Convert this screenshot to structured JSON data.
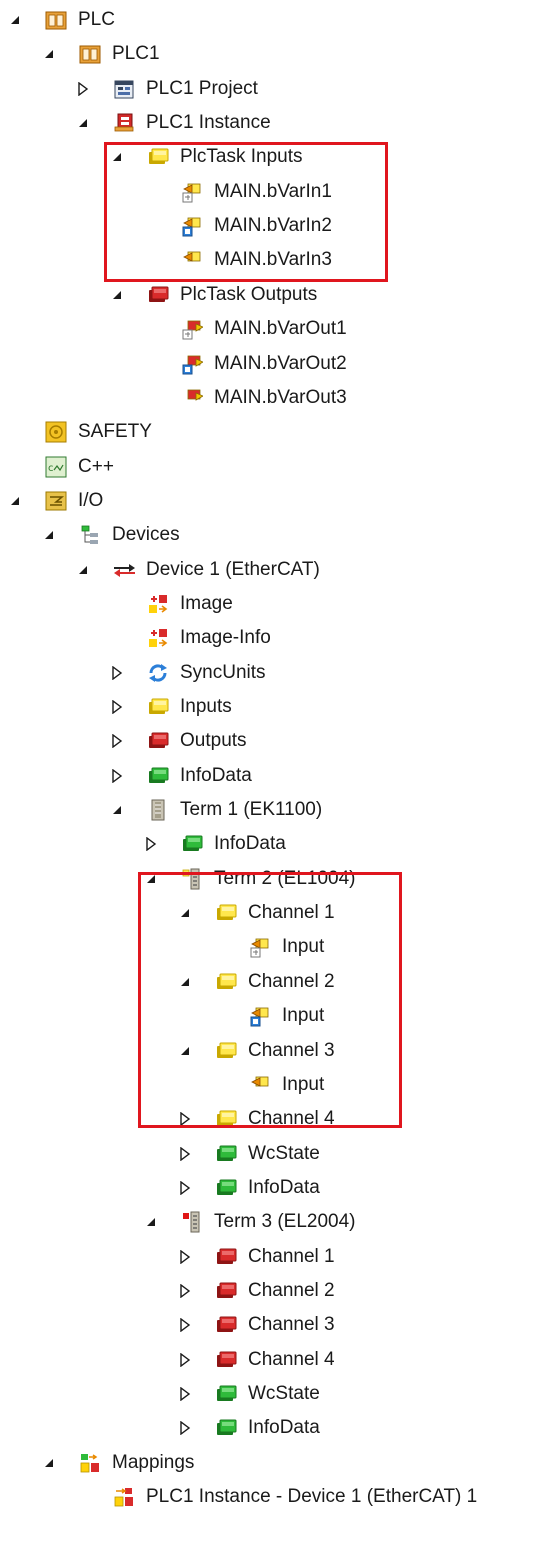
{
  "tree": {
    "rows": [
      {
        "label": "PLC",
        "depth": 0,
        "state": "expanded",
        "icon": "plc-icon"
      },
      {
        "label": "PLC1",
        "depth": 1,
        "state": "expanded",
        "icon": "plc-icon"
      },
      {
        "label": "PLC1 Project",
        "depth": 2,
        "state": "collapsed",
        "icon": "project-icon"
      },
      {
        "label": "PLC1 Instance",
        "depth": 2,
        "state": "expanded",
        "icon": "instance-icon"
      },
      {
        "label": "PlcTask Inputs",
        "depth": 3,
        "state": "expanded",
        "icon": "yellow-inputs-icon"
      },
      {
        "label": "MAIN.bVarIn1",
        "depth": 4,
        "state": "none",
        "icon": "input-variable-unlinked-icon"
      },
      {
        "label": "MAIN.bVarIn2",
        "depth": 4,
        "state": "none",
        "icon": "input-variable-linked-icon"
      },
      {
        "label": "MAIN.bVarIn3",
        "depth": 4,
        "state": "none",
        "icon": "input-variable-icon"
      },
      {
        "label": "PlcTask Outputs",
        "depth": 3,
        "state": "expanded",
        "icon": "red-outputs-icon"
      },
      {
        "label": "MAIN.bVarOut1",
        "depth": 4,
        "state": "none",
        "icon": "output-variable-unlinked-icon"
      },
      {
        "label": "MAIN.bVarOut2",
        "depth": 4,
        "state": "none",
        "icon": "output-variable-linked-icon"
      },
      {
        "label": "MAIN.bVarOut3",
        "depth": 4,
        "state": "none",
        "icon": "output-variable-icon"
      },
      {
        "label": "SAFETY",
        "depth": 0,
        "state": "none",
        "icon": "safety-icon"
      },
      {
        "label": "C++",
        "depth": 0,
        "state": "none",
        "icon": "cpp-icon"
      },
      {
        "label": "I/O",
        "depth": 0,
        "state": "expanded",
        "icon": "io-icon"
      },
      {
        "label": "Devices",
        "depth": 1,
        "state": "expanded",
        "icon": "devices-icon"
      },
      {
        "label": "Device 1 (EtherCAT)",
        "depth": 2,
        "state": "expanded",
        "icon": "ethercat-device-icon"
      },
      {
        "label": "Image",
        "depth": 3,
        "state": "none",
        "icon": "image-icon"
      },
      {
        "label": "Image-Info",
        "depth": 3,
        "state": "none",
        "icon": "image-icon"
      },
      {
        "label": "SyncUnits",
        "depth": 3,
        "state": "collapsed",
        "icon": "syncunits-icon"
      },
      {
        "label": "Inputs",
        "depth": 3,
        "state": "collapsed",
        "icon": "yellow-inputs-icon"
      },
      {
        "label": "Outputs",
        "depth": 3,
        "state": "collapsed",
        "icon": "red-outputs-icon"
      },
      {
        "label": "InfoData",
        "depth": 3,
        "state": "collapsed",
        "icon": "green-infodata-icon"
      },
      {
        "label": "Term 1 (EK1100)",
        "depth": 3,
        "state": "expanded",
        "icon": "coupler-terminal-icon"
      },
      {
        "label": "InfoData",
        "depth": 4,
        "state": "collapsed",
        "icon": "green-infodata-icon"
      },
      {
        "label": "Term 2 (EL1004)",
        "depth": 4,
        "state": "expanded",
        "icon": "input-terminal-icon"
      },
      {
        "label": "Channel 1",
        "depth": 5,
        "state": "expanded",
        "icon": "yellow-inputs-icon"
      },
      {
        "label": "Input",
        "depth": 6,
        "state": "none",
        "icon": "input-variable-unlinked-icon"
      },
      {
        "label": "Channel 2",
        "depth": 5,
        "state": "expanded",
        "icon": "yellow-inputs-icon"
      },
      {
        "label": "Input",
        "depth": 6,
        "state": "none",
        "icon": "input-variable-linked-icon"
      },
      {
        "label": "Channel 3",
        "depth": 5,
        "state": "expanded",
        "icon": "yellow-inputs-icon"
      },
      {
        "label": "Input",
        "depth": 6,
        "state": "none",
        "icon": "input-variable-icon"
      },
      {
        "label": "Channel 4",
        "depth": 5,
        "state": "collapsed",
        "icon": "yellow-inputs-icon"
      },
      {
        "label": "WcState",
        "depth": 5,
        "state": "collapsed",
        "icon": "green-infodata-icon"
      },
      {
        "label": "InfoData",
        "depth": 5,
        "state": "collapsed",
        "icon": "green-infodata-icon"
      },
      {
        "label": "Term 3 (EL2004)",
        "depth": 4,
        "state": "expanded",
        "icon": "output-terminal-icon"
      },
      {
        "label": "Channel 1",
        "depth": 5,
        "state": "collapsed",
        "icon": "red-outputs-icon"
      },
      {
        "label": "Channel 2",
        "depth": 5,
        "state": "collapsed",
        "icon": "red-outputs-icon"
      },
      {
        "label": "Channel 3",
        "depth": 5,
        "state": "collapsed",
        "icon": "red-outputs-icon"
      },
      {
        "label": "Channel 4",
        "depth": 5,
        "state": "collapsed",
        "icon": "red-outputs-icon"
      },
      {
        "label": "WcState",
        "depth": 5,
        "state": "collapsed",
        "icon": "green-infodata-icon"
      },
      {
        "label": "InfoData",
        "depth": 5,
        "state": "collapsed",
        "icon": "green-infodata-icon"
      },
      {
        "label": "Mappings",
        "depth": 1,
        "state": "expanded",
        "icon": "mappings-icon"
      },
      {
        "label": "PLC1 Instance - Device 1 (EtherCAT) 1",
        "depth": 2,
        "state": "none",
        "icon": "mapping-entry-icon"
      }
    ]
  },
  "colors": {
    "highlight": "#e0161e",
    "arrow": "#1a1a1a",
    "text": "#1a1a1a"
  }
}
